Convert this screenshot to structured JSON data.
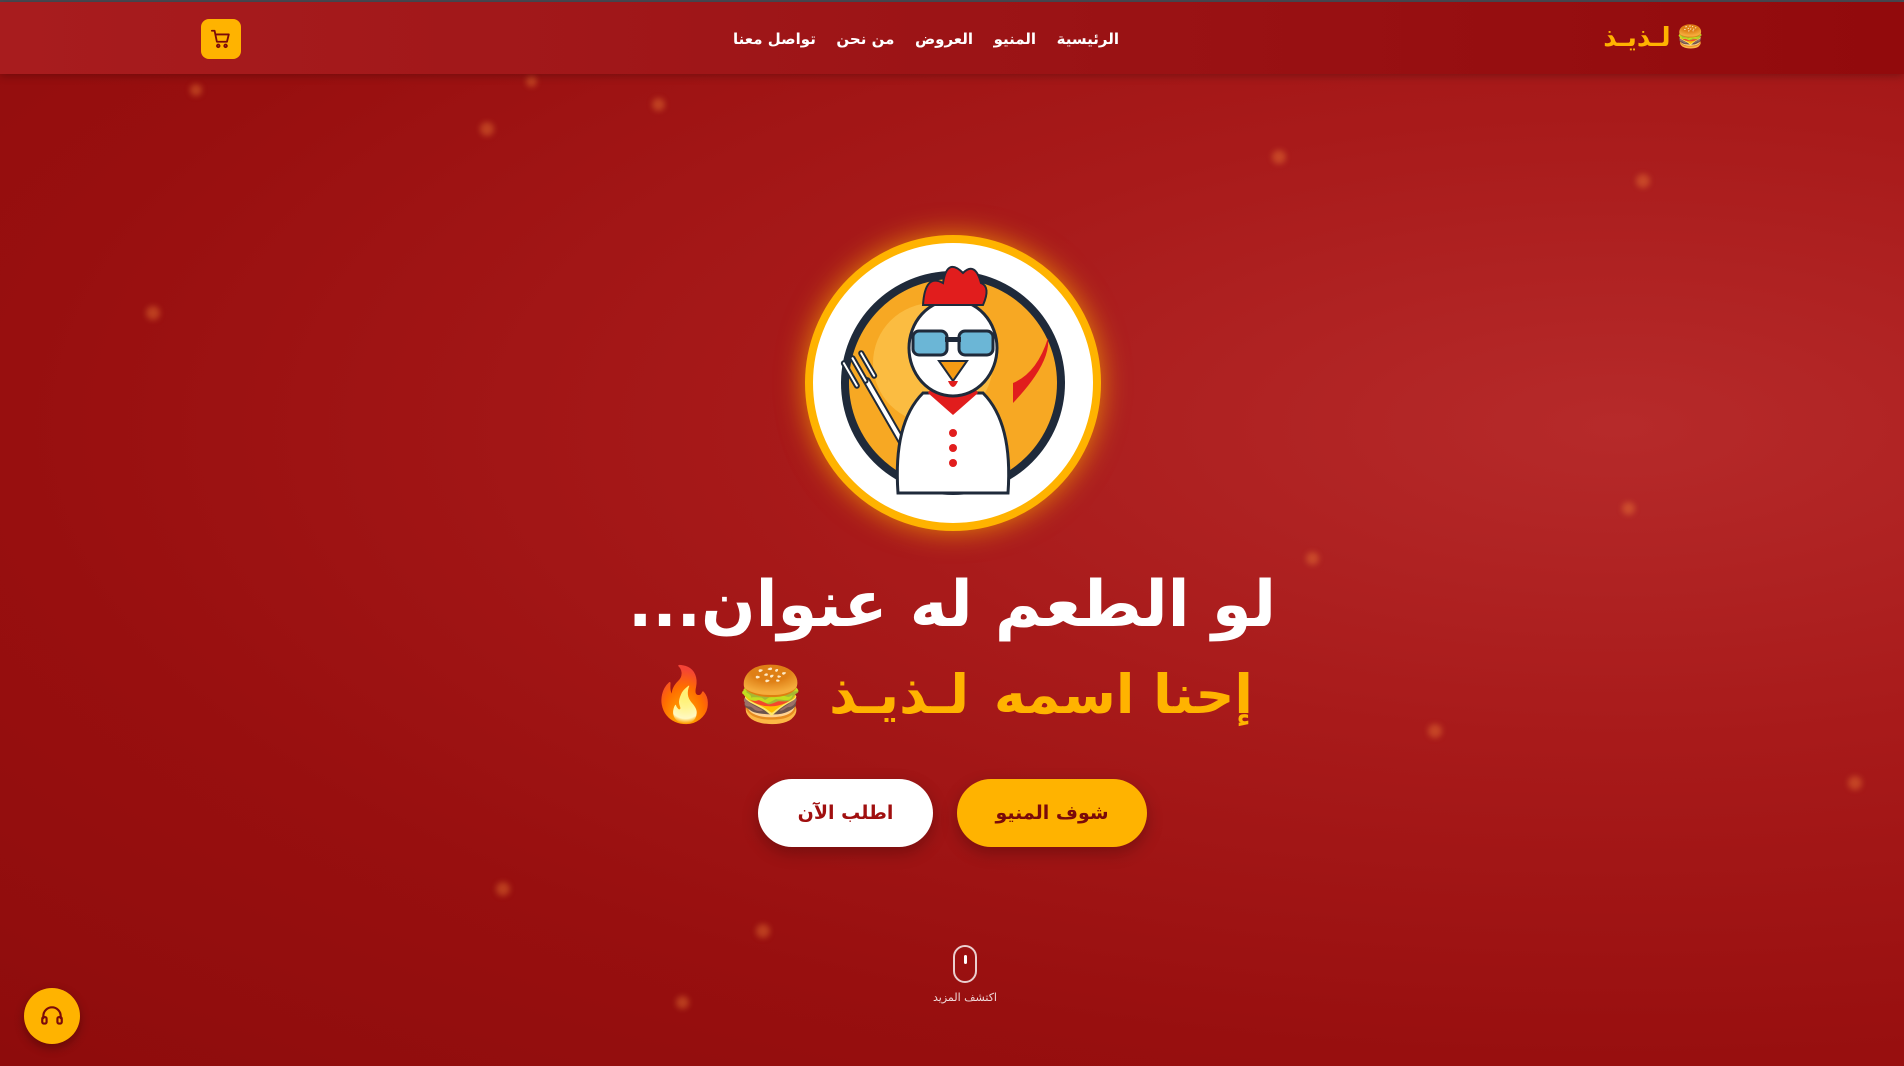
{
  "brand": {
    "name": "لـذيـذ",
    "icon": "burger-icon"
  },
  "nav": {
    "links": [
      "الرئيسية",
      "المنيو",
      "العروض",
      "من نحن",
      "تواصل معنا"
    ]
  },
  "cart": {
    "icon": "cart-icon"
  },
  "hero": {
    "headline": "لو الطعم له عنوان...",
    "subline_prefix": "إحنا اسمه",
    "subline_brand": "لـذيـذ",
    "subline_emojis": "🍔 🔥"
  },
  "buttons": {
    "menu": "شوف المنيو",
    "order": "اطلب الآن"
  },
  "scroll": {
    "label": "اكتشف المزيد"
  },
  "support": {
    "icon": "headset-icon"
  },
  "colors": {
    "accent": "#ffb300",
    "primary": "#a81a1a"
  }
}
